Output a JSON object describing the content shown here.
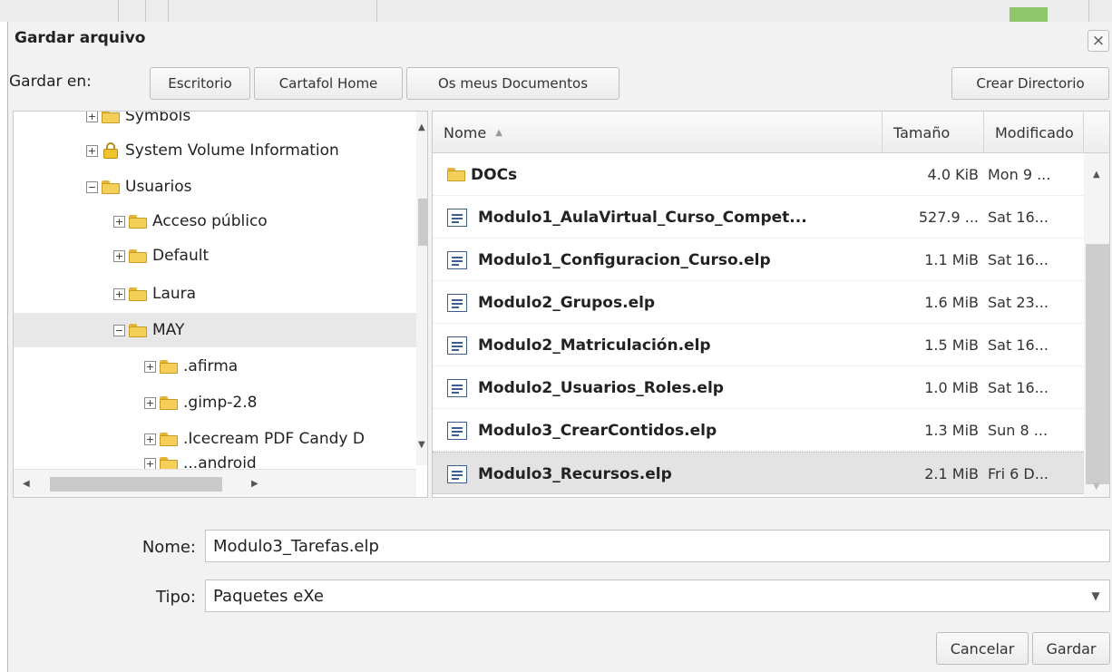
{
  "dialog": {
    "title": "Gardar arquivo",
    "close_glyph": "×"
  },
  "location": {
    "label": "Gardar en:",
    "buttons": [
      "Escritorio",
      "Cartafol Home",
      "Os meus Documentos"
    ],
    "create_dir": "Crear Directorio"
  },
  "tree": {
    "items": [
      {
        "label": "Symbols",
        "expander": "+",
        "icon": "folder-icon"
      },
      {
        "label": "System Volume Information",
        "expander": "+",
        "icon": "lock-icon"
      },
      {
        "label": "Usuarios",
        "expander": "−",
        "icon": "folder-open-icon"
      },
      {
        "label": "Acceso público",
        "expander": "+",
        "icon": "folder-icon"
      },
      {
        "label": "Default",
        "expander": "+",
        "icon": "folder-icon"
      },
      {
        "label": "Laura",
        "expander": "+",
        "icon": "folder-icon"
      },
      {
        "label": "MAY",
        "expander": "−",
        "icon": "folder-open-icon"
      },
      {
        "label": ".afirma",
        "expander": "+",
        "icon": "folder-icon"
      },
      {
        "label": ".gimp-2.8",
        "expander": "+",
        "icon": "folder-icon"
      },
      {
        "label": ".Icecream PDF Candy D",
        "expander": "+",
        "icon": "folder-icon"
      },
      {
        "label": "...android",
        "expander": "+",
        "icon": "folder-icon"
      }
    ]
  },
  "files": {
    "columns": {
      "name": "Nome",
      "sort_glyph": "▲",
      "size": "Tamaño",
      "modified": "Modificado"
    },
    "rows": [
      {
        "name": "DOCs",
        "size": "4.0 KiB",
        "date": "Mon 9 ...",
        "icon": "folder-icon"
      },
      {
        "name": "Modulo1_AulaVirtual_Curso_Compet...",
        "size": "527.9 ...",
        "date": "Sat 16...",
        "icon": "document-icon"
      },
      {
        "name": "Modulo1_Configuracion_Curso.elp",
        "size": "1.1 MiB",
        "date": "Sat 16...",
        "icon": "document-icon"
      },
      {
        "name": "Modulo2_Grupos.elp",
        "size": "1.6 MiB",
        "date": "Sat 23...",
        "icon": "document-icon"
      },
      {
        "name": "Modulo2_Matriculación.elp",
        "size": "1.5 MiB",
        "date": "Sat 16...",
        "icon": "document-icon"
      },
      {
        "name": "Modulo2_Usuarios_Roles.elp",
        "size": "1.0 MiB",
        "date": "Sat 16...",
        "icon": "document-icon"
      },
      {
        "name": "Modulo3_CrearContidos.elp",
        "size": "1.3 MiB",
        "date": "Sun 8 ...",
        "icon": "document-icon"
      },
      {
        "name": "Modulo3_Recursos.elp",
        "size": "2.1 MiB",
        "date": "Fri 6 D...",
        "icon": "document-icon"
      }
    ]
  },
  "form": {
    "name_label": "Nome:",
    "name_value": "Modulo3_Tarefas.elp",
    "type_label": "Tipo:",
    "type_value": "Paquetes eXe"
  },
  "actions": {
    "cancel": "Cancelar",
    "save": "Gardar"
  }
}
